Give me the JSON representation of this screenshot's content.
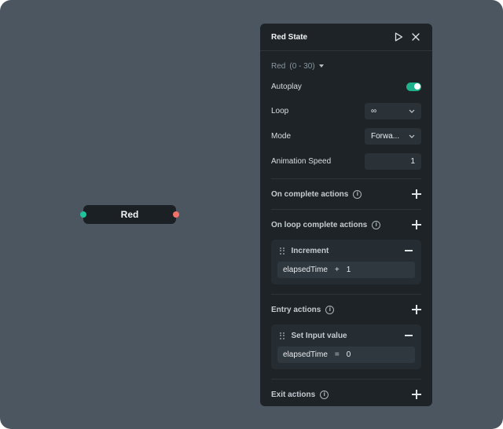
{
  "node": {
    "label": "Red"
  },
  "panel": {
    "title": "Red State",
    "icons": {
      "play": "play-icon",
      "close": "close-icon"
    },
    "animation": {
      "name": "Red",
      "range": "(0 - 30)"
    },
    "props": {
      "autoplay": {
        "label": "Autoplay",
        "value": true
      },
      "loop": {
        "label": "Loop",
        "value": "∞"
      },
      "mode": {
        "label": "Mode",
        "value": "Forwa..."
      },
      "speed": {
        "label": "Animation Speed",
        "value": "1"
      }
    },
    "sections": {
      "on_complete": {
        "label": "On complete actions"
      },
      "on_loop_complete": {
        "label": "On loop complete actions",
        "action": {
          "title": "Increment",
          "variable": "elapsedTime",
          "operator": "+",
          "value": "1"
        }
      },
      "entry": {
        "label": "Entry actions",
        "action": {
          "title": "Set Input value",
          "variable": "elapsedTime",
          "operator": "=",
          "value": "0"
        }
      },
      "exit": {
        "label": "Exit actions"
      }
    }
  },
  "colors": {
    "canvas": "#4c5661",
    "panel": "#1d2327",
    "accent": "#1fb08c",
    "port_in": "#1fc39a",
    "port_out": "#f2706a"
  }
}
